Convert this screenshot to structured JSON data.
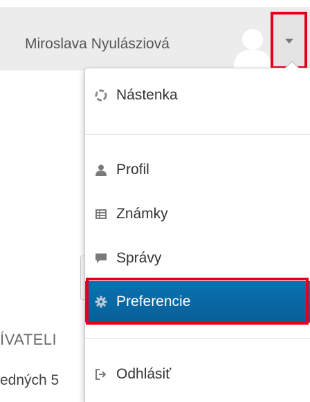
{
  "navbar": {
    "user_name": "Miroslava Nyulásziová",
    "avatar_icon": "user-avatar-icon",
    "toggle_icon": "caret-down-icon"
  },
  "background": {
    "heading_fragment": "ÍVATELI",
    "sub_fragment": "edných 5"
  },
  "user_menu": {
    "items": [
      {
        "label": "Nástenka",
        "icon": "dashboard-icon",
        "active": false
      },
      {
        "label": "Profil",
        "icon": "user-icon",
        "active": false
      },
      {
        "label": "Známky",
        "icon": "grades-table-icon",
        "active": false
      },
      {
        "label": "Správy",
        "icon": "message-icon",
        "active": false
      },
      {
        "label": "Preferencie",
        "icon": "gear-icon",
        "active": true
      },
      {
        "label": "Odhlásiť",
        "icon": "logout-icon",
        "active": false
      }
    ]
  },
  "colors": {
    "active_bg": "#075f96",
    "highlight_border": "#e3001b",
    "navbar_bg": "#ececec"
  }
}
